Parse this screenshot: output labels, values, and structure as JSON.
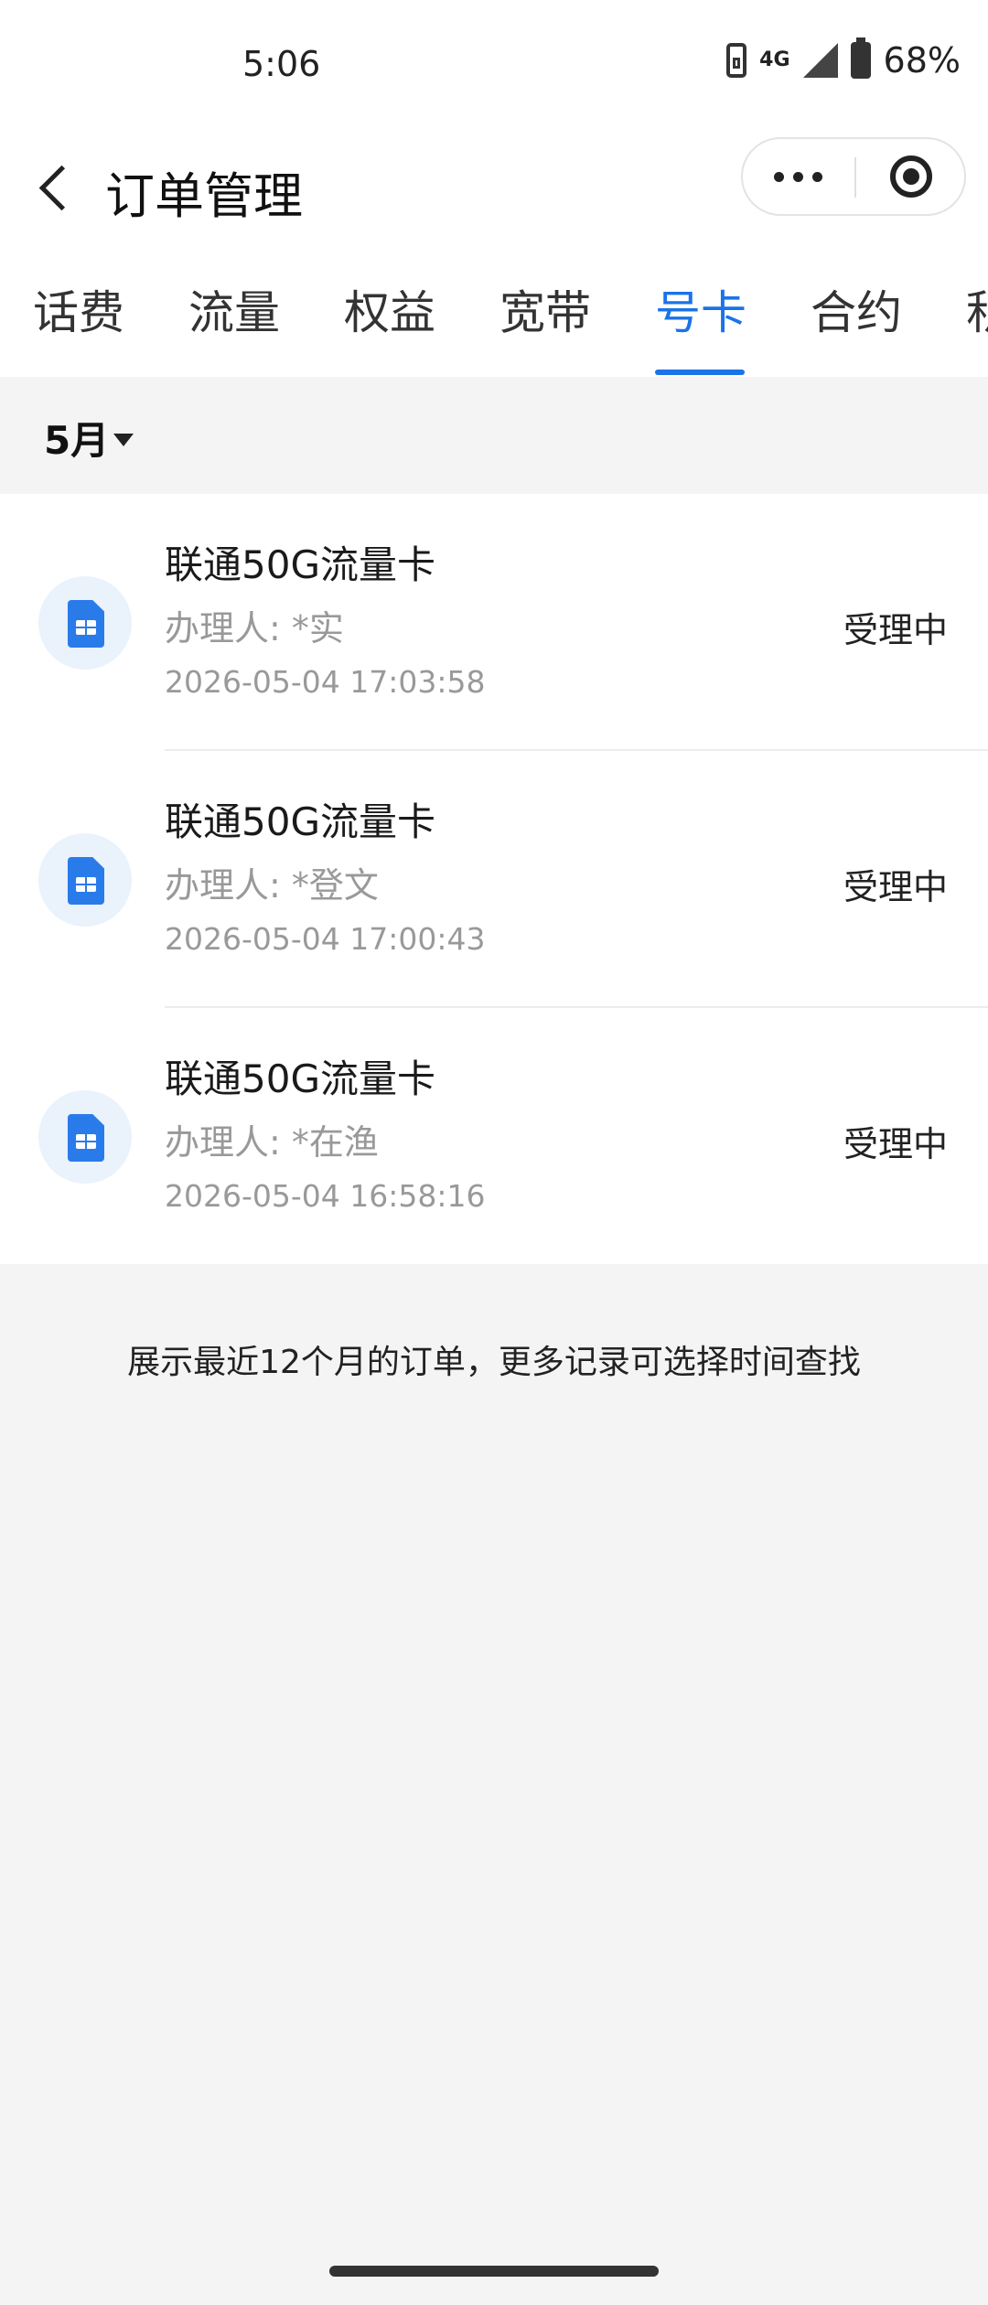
{
  "status_bar": {
    "time": "5:06",
    "network": "4G",
    "battery": "68%"
  },
  "header": {
    "title": "订单管理"
  },
  "tabs": [
    {
      "label": "话费"
    },
    {
      "label": "流量"
    },
    {
      "label": "权益"
    },
    {
      "label": "宽带"
    },
    {
      "label": "号卡"
    },
    {
      "label": "合约"
    },
    {
      "label": "积"
    }
  ],
  "active_tab": "号卡",
  "filter": {
    "month": "5月"
  },
  "orders": [
    {
      "name": "联通50G流量卡",
      "handler": "办理人: *实",
      "time": "2026-05-04 17:03:58",
      "status": "受理中"
    },
    {
      "name": "联通50G流量卡",
      "handler": "办理人: *登文",
      "time": "2026-05-04 17:00:43",
      "status": "受理中"
    },
    {
      "name": "联通50G流量卡",
      "handler": "办理人: *在渔",
      "time": "2026-05-04 16:58:16",
      "status": "受理中"
    }
  ],
  "footer_note": "展示最近12个月的订单，更多记录可选择时间查找",
  "colors": {
    "accent": "#1a73e8",
    "icon_blue": "#2a7bea",
    "background": "#f4f4f4"
  }
}
